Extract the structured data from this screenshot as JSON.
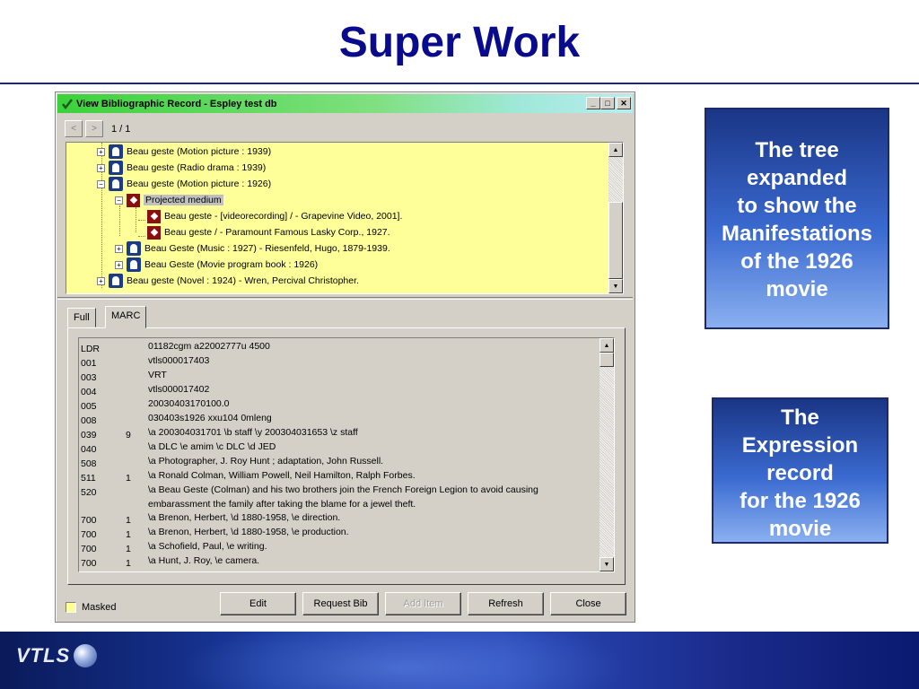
{
  "slide": {
    "title": "Super Work"
  },
  "window": {
    "title": "View Bibliographic Record - Espley test db",
    "buttons": {
      "minimize": "_",
      "maximize": "□",
      "close": "✕"
    },
    "nav": {
      "prev": "<",
      "next": ">",
      "count": "1 / 1"
    }
  },
  "tree": {
    "items": [
      {
        "label": "Beau geste (Motion picture : 1939)",
        "type": "person",
        "expander": "+"
      },
      {
        "label": "Beau geste (Radio drama : 1939)",
        "type": "person",
        "expander": "+"
      },
      {
        "label": "Beau geste (Motion picture : 1926)",
        "type": "person",
        "expander": "−"
      },
      {
        "label": "Projected medium",
        "type": "medium",
        "expander": "−"
      },
      {
        "label": "Beau geste - [videorecording] / - Grapevine Video, 2001].",
        "type": "medium",
        "expander": ""
      },
      {
        "label": "Beau geste / - Paramount Famous Lasky Corp., 1927.",
        "type": "medium",
        "expander": ""
      },
      {
        "label": "Beau Geste (Music : 1927) - Riesenfeld, Hugo, 1879-1939.",
        "type": "person",
        "expander": "+"
      },
      {
        "label": "Beau Geste (Movie program book : 1926)",
        "type": "person",
        "expander": "+"
      },
      {
        "label": "Beau geste (Novel : 1924) - Wren, Percival Christopher.",
        "type": "person",
        "expander": "+"
      }
    ]
  },
  "tabs": [
    {
      "label": "Full"
    },
    {
      "label": "MARC"
    }
  ],
  "marc": {
    "rows": [
      {
        "tag": "LDR",
        "ind": "",
        "data": "01182cgm a22002777u 4500"
      },
      {
        "tag": "001",
        "ind": "",
        "data": "vtls000017403"
      },
      {
        "tag": "003",
        "ind": "",
        "data": "VRT"
      },
      {
        "tag": "004",
        "ind": "",
        "data": "vtls000017402"
      },
      {
        "tag": "005",
        "ind": "",
        "data": "20030403170100.0"
      },
      {
        "tag": "008",
        "ind": "",
        "data": "030403s1926    xxu104          0mleng"
      },
      {
        "tag": "039",
        "ind": "9",
        "data": "\\a 200304031701 \\b staff \\y 200304031653 \\z staff"
      },
      {
        "tag": "040",
        "ind": "",
        "data": "\\a DLC \\e amim \\c DLC \\d JED"
      },
      {
        "tag": "508",
        "ind": "",
        "data": "\\a Photographer, J. Roy Hunt ; adaptation, John Russell."
      },
      {
        "tag": "511",
        "ind": "1",
        "data": "\\a Ronald Colman, William Powell, Neil Hamilton, Ralph Forbes."
      },
      {
        "tag": "520",
        "ind": "",
        "data": "\\a Beau Geste (Colman) and his two brothers join the French Foreign Legion to avoid causing"
      },
      {
        "tag": "",
        "ind": "",
        "data": "embarassment the family after taking the blame for a jewel theft."
      },
      {
        "tag": "700",
        "ind": "1",
        "data": "\\a Brenon, Herbert, \\d 1880-1958, \\e direction."
      },
      {
        "tag": "700",
        "ind": "1",
        "data": "\\a Brenon, Herbert, \\d 1880-1958, \\e production."
      },
      {
        "tag": "700",
        "ind": "1",
        "data": "\\a Schofield, Paul, \\e writing."
      },
      {
        "tag": "700",
        "ind": "1",
        "data": "\\a Hunt, J. Roy, \\e camera."
      }
    ]
  },
  "bottom": {
    "masked_label": "Masked",
    "buttons": [
      {
        "label": "Edit",
        "enabled": true
      },
      {
        "label": "Request Bib",
        "enabled": true
      },
      {
        "label": "Add Item",
        "enabled": false
      },
      {
        "label": "Refresh",
        "enabled": true
      },
      {
        "label": "Close",
        "enabled": true
      }
    ]
  },
  "callouts": [
    {
      "lines": [
        "The tree",
        "expanded",
        "to show the",
        "Manifestations",
        "of the 1926",
        "movie"
      ]
    },
    {
      "lines": [
        "The",
        "Expression",
        "record",
        "for the 1926",
        "movie"
      ]
    }
  ],
  "footer": {
    "logo_text": "VTLS"
  },
  "colors": {
    "title": "#0a0a8c",
    "tree_bg": "#ffff99",
    "callout_top": "#1a3585",
    "callout_bottom": "#8ab0f0"
  }
}
